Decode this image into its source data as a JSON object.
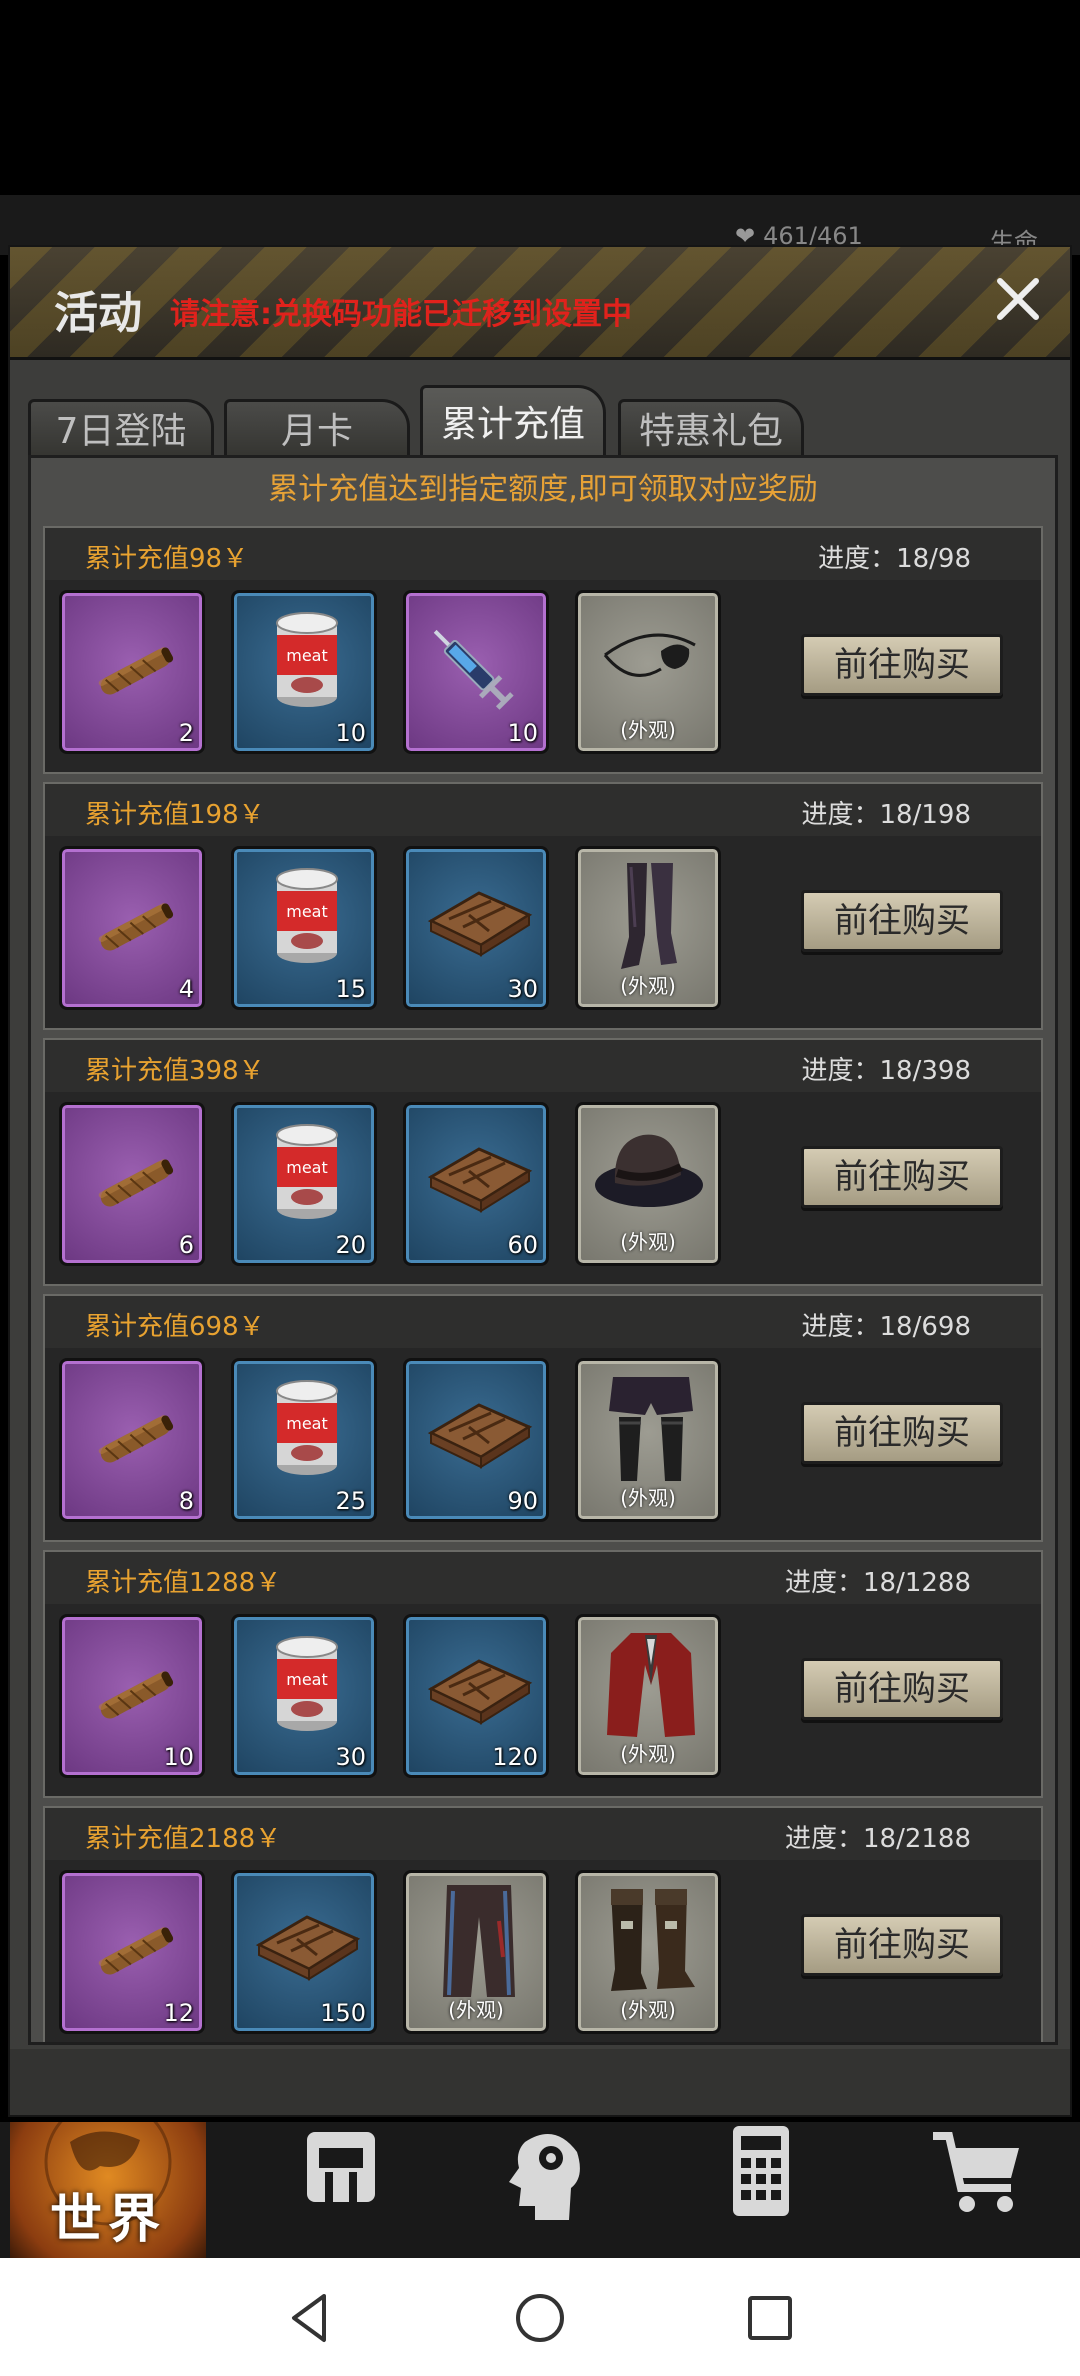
{
  "hud": {
    "hp": "461/461",
    "life_label": "生命"
  },
  "dialog": {
    "title": "活动",
    "notice": "请注意:兑换码功能已迁移到设置中",
    "tabs": [
      {
        "label": "7日登陆",
        "active": false
      },
      {
        "label": "月卡",
        "active": false
      },
      {
        "label": "累计充值",
        "active": true
      },
      {
        "label": "特惠礼包",
        "active": false
      }
    ],
    "info": "累计充值达到指定额度,即可领取对应奖励",
    "button_label": "前往购买",
    "skin_tag": "(外观)",
    "tiers": [
      {
        "title": "累计充值98￥",
        "progress": "进度：18/98",
        "items": [
          {
            "name": "cigar",
            "rarity": "purple",
            "count": "2"
          },
          {
            "name": "meat-can",
            "rarity": "blue",
            "count": "10"
          },
          {
            "name": "syringe",
            "rarity": "purple",
            "count": "10"
          },
          {
            "name": "eyepatch",
            "rarity": "gray",
            "count": "",
            "skin": true
          }
        ]
      },
      {
        "title": "累计充值198￥",
        "progress": "进度：18/198",
        "items": [
          {
            "name": "cigar",
            "rarity": "purple",
            "count": "4"
          },
          {
            "name": "meat-can",
            "rarity": "blue",
            "count": "15"
          },
          {
            "name": "wood-crate",
            "rarity": "blue",
            "count": "30"
          },
          {
            "name": "thigh-boots",
            "rarity": "gray",
            "count": "",
            "skin": true
          }
        ]
      },
      {
        "title": "累计充值398￥",
        "progress": "进度：18/398",
        "items": [
          {
            "name": "cigar",
            "rarity": "purple",
            "count": "6"
          },
          {
            "name": "meat-can",
            "rarity": "blue",
            "count": "20"
          },
          {
            "name": "wood-crate",
            "rarity": "blue",
            "count": "60"
          },
          {
            "name": "hat",
            "rarity": "gray",
            "count": "",
            "skin": true
          }
        ]
      },
      {
        "title": "累计充值698￥",
        "progress": "进度：18/698",
        "items": [
          {
            "name": "cigar",
            "rarity": "purple",
            "count": "8"
          },
          {
            "name": "meat-can",
            "rarity": "blue",
            "count": "25"
          },
          {
            "name": "wood-crate",
            "rarity": "blue",
            "count": "90"
          },
          {
            "name": "shorts-stockings",
            "rarity": "gray",
            "count": "",
            "skin": true
          }
        ]
      },
      {
        "title": "累计充值1288￥",
        "progress": "进度：18/1288",
        "items": [
          {
            "name": "cigar",
            "rarity": "purple",
            "count": "10"
          },
          {
            "name": "meat-can",
            "rarity": "blue",
            "count": "30"
          },
          {
            "name": "wood-crate",
            "rarity": "blue",
            "count": "120"
          },
          {
            "name": "red-coat",
            "rarity": "gray",
            "count": "",
            "skin": true
          }
        ]
      },
      {
        "title": "累计充值2188￥",
        "progress": "进度：18/2188",
        "items": [
          {
            "name": "cigar",
            "rarity": "purple",
            "count": "12"
          },
          {
            "name": "wood-crate",
            "rarity": "blue",
            "count": "150"
          },
          {
            "name": "trousers",
            "rarity": "gray",
            "count": "",
            "skin": true
          },
          {
            "name": "buckle-boots",
            "rarity": "gray",
            "count": "",
            "skin": true
          }
        ]
      }
    ]
  },
  "bottom_nav": [
    {
      "label": "世界",
      "icon": "globe-icon",
      "active": true
    },
    {
      "label": "",
      "icon": "backpack-icon"
    },
    {
      "label": "",
      "icon": "head-gear-icon"
    },
    {
      "label": "",
      "icon": "calculator-icon"
    },
    {
      "label": "",
      "icon": "cart-icon"
    }
  ],
  "system_nav": [
    "back-icon",
    "home-icon",
    "recents-icon"
  ]
}
